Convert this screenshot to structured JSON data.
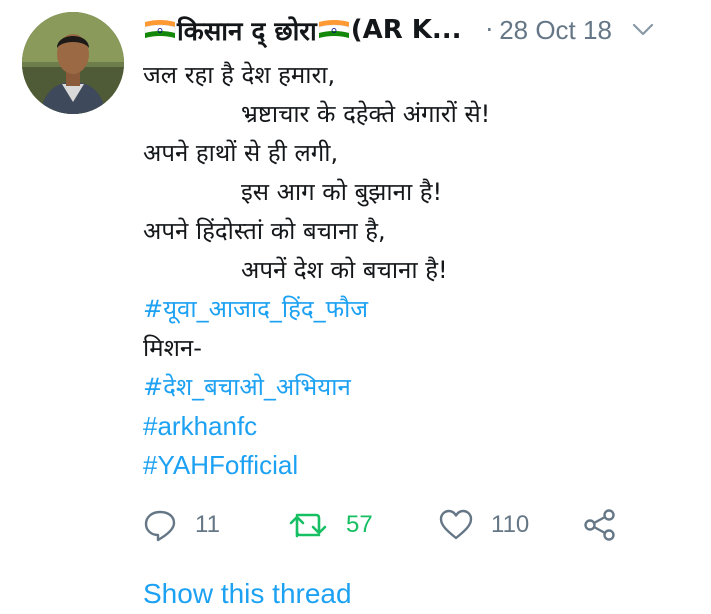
{
  "tweet": {
    "display_name": "किसान द् छोरा",
    "name_suffix": "(AR K...",
    "separator": "·",
    "date": "28 Oct 18",
    "lines": [
      "जल रहा है देश हमारा,",
      "भ्रष्टाचार के दहेक्ते अंगारों से!",
      "अपने हाथों से ही लगी,",
      "इस आग को बुझाना है!",
      "अपने हिंदोस्तां को बचाना है,",
      "अपनें देश को बचाना है!"
    ],
    "hashtag_1": "#यूवा_आजाद_हिंद_फौज",
    "mission_label": "मिशन-",
    "hashtag_2": "#देश_बचाओ_अभियान",
    "hashtag_3": "#arkhanfc",
    "hashtag_4": "#YAHFofficial"
  },
  "actions": {
    "replies": "11",
    "retweets": "57",
    "likes": "110"
  },
  "show_thread_label": "Show this thread",
  "icons": {
    "flag": "india-flag-icon",
    "caret": "chevron-down-icon",
    "reply": "reply-icon",
    "retweet": "retweet-icon",
    "like": "heart-icon",
    "share": "share-icon"
  },
  "colors": {
    "link": "#1da1f2",
    "muted": "#657786",
    "retweet": "#17bf63",
    "text": "#14171a"
  }
}
